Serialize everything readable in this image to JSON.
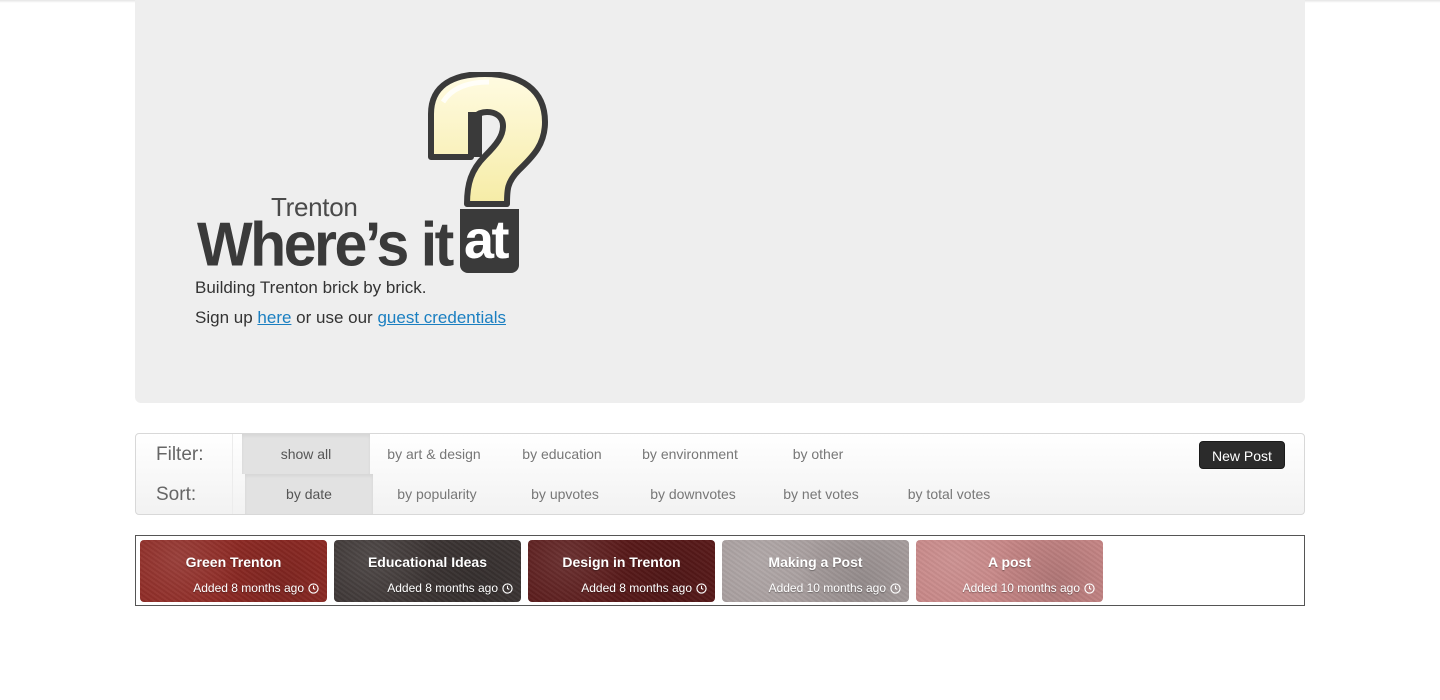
{
  "hero": {
    "logo_subtitle": "Trenton",
    "logo_title": "Where’s it",
    "logo_at": "at",
    "tagline": "Building Trenton brick by brick.",
    "signup_prefix": "Sign up",
    "signup_link": "here",
    "signup_middle": "or use our",
    "guest_link": "guest credentials"
  },
  "filter": {
    "label": "Filter:",
    "options": [
      "show all",
      "by art & design",
      "by education",
      "by environment",
      "by other"
    ],
    "active": "show all"
  },
  "sort": {
    "label": "Sort:",
    "options": [
      "by date",
      "by popularity",
      "by upvotes",
      "by downvotes",
      "by net votes",
      "by total votes"
    ],
    "active": "by date"
  },
  "new_post_label": "New Post",
  "posts": [
    {
      "title": "Green Trenton",
      "added": "Added 8 months ago",
      "color": "#8e2a24"
    },
    {
      "title": "Educational Ideas",
      "added": "Added 8 months ago",
      "color": "#3c3534"
    },
    {
      "title": "Design in Trenton",
      "added": "Added 8 months ago",
      "color": "#5a1a1a"
    },
    {
      "title": "Making a Post",
      "added": "Added 10 months ago",
      "color": "#a89e9e"
    },
    {
      "title": "A post",
      "added": "Added 10 months ago",
      "color": "#c78686"
    }
  ]
}
